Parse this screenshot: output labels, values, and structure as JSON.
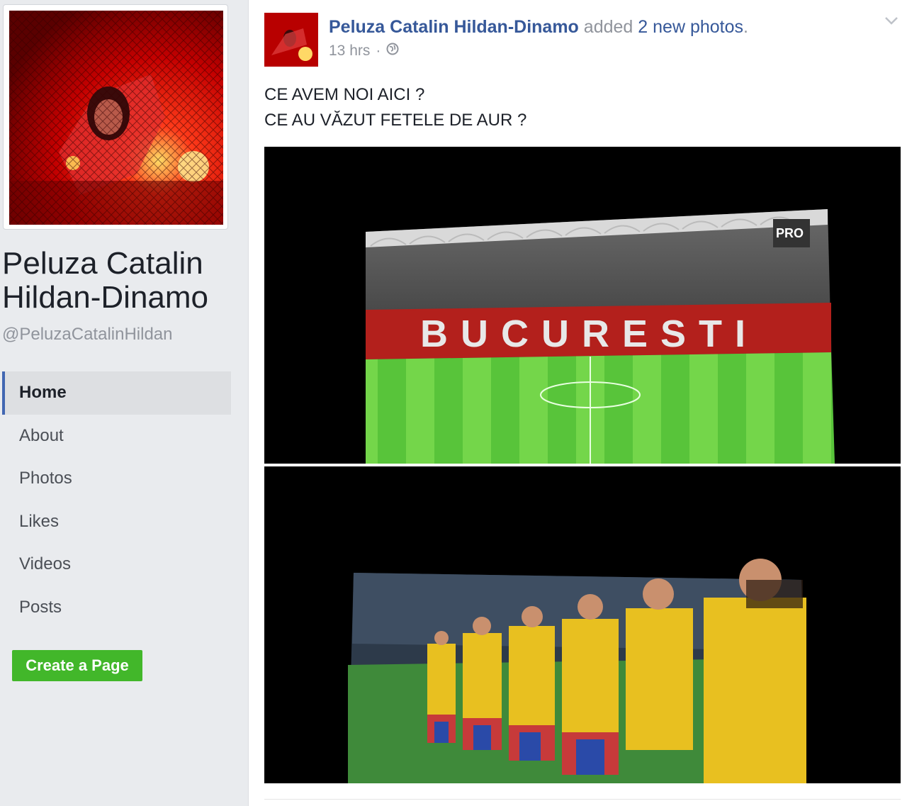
{
  "page": {
    "name": "Peluza Catalin Hildan-Dinamo",
    "handle": "@PeluzaCatalinHildan",
    "profile_image_icon": "profile-photo-flares"
  },
  "nav": {
    "items": [
      {
        "label": "Home",
        "active": true
      },
      {
        "label": "About",
        "active": false
      },
      {
        "label": "Photos",
        "active": false
      },
      {
        "label": "Likes",
        "active": false
      },
      {
        "label": "Videos",
        "active": false
      },
      {
        "label": "Posts",
        "active": false
      }
    ]
  },
  "create_page_button": "Create a Page",
  "post": {
    "author": "Peluza Catalin Hildan-Dinamo",
    "action_prefix": "added",
    "action_link": "2 new photos",
    "action_suffix": ".",
    "timestamp": "13 hrs",
    "separator": "·",
    "privacy_icon": "globe-icon",
    "text_line1": "CE AVEM NOI AICI ?",
    "text_line2": "CE AU VĂZUT FETELE DE AUR ?",
    "photo1_banner": "BUCURESTI",
    "broadcaster_logo": "PRO"
  },
  "colors": {
    "link": "#365899",
    "accent_nav": "#4267b2",
    "button": "#42b72a",
    "secondary_text": "#90949c"
  }
}
